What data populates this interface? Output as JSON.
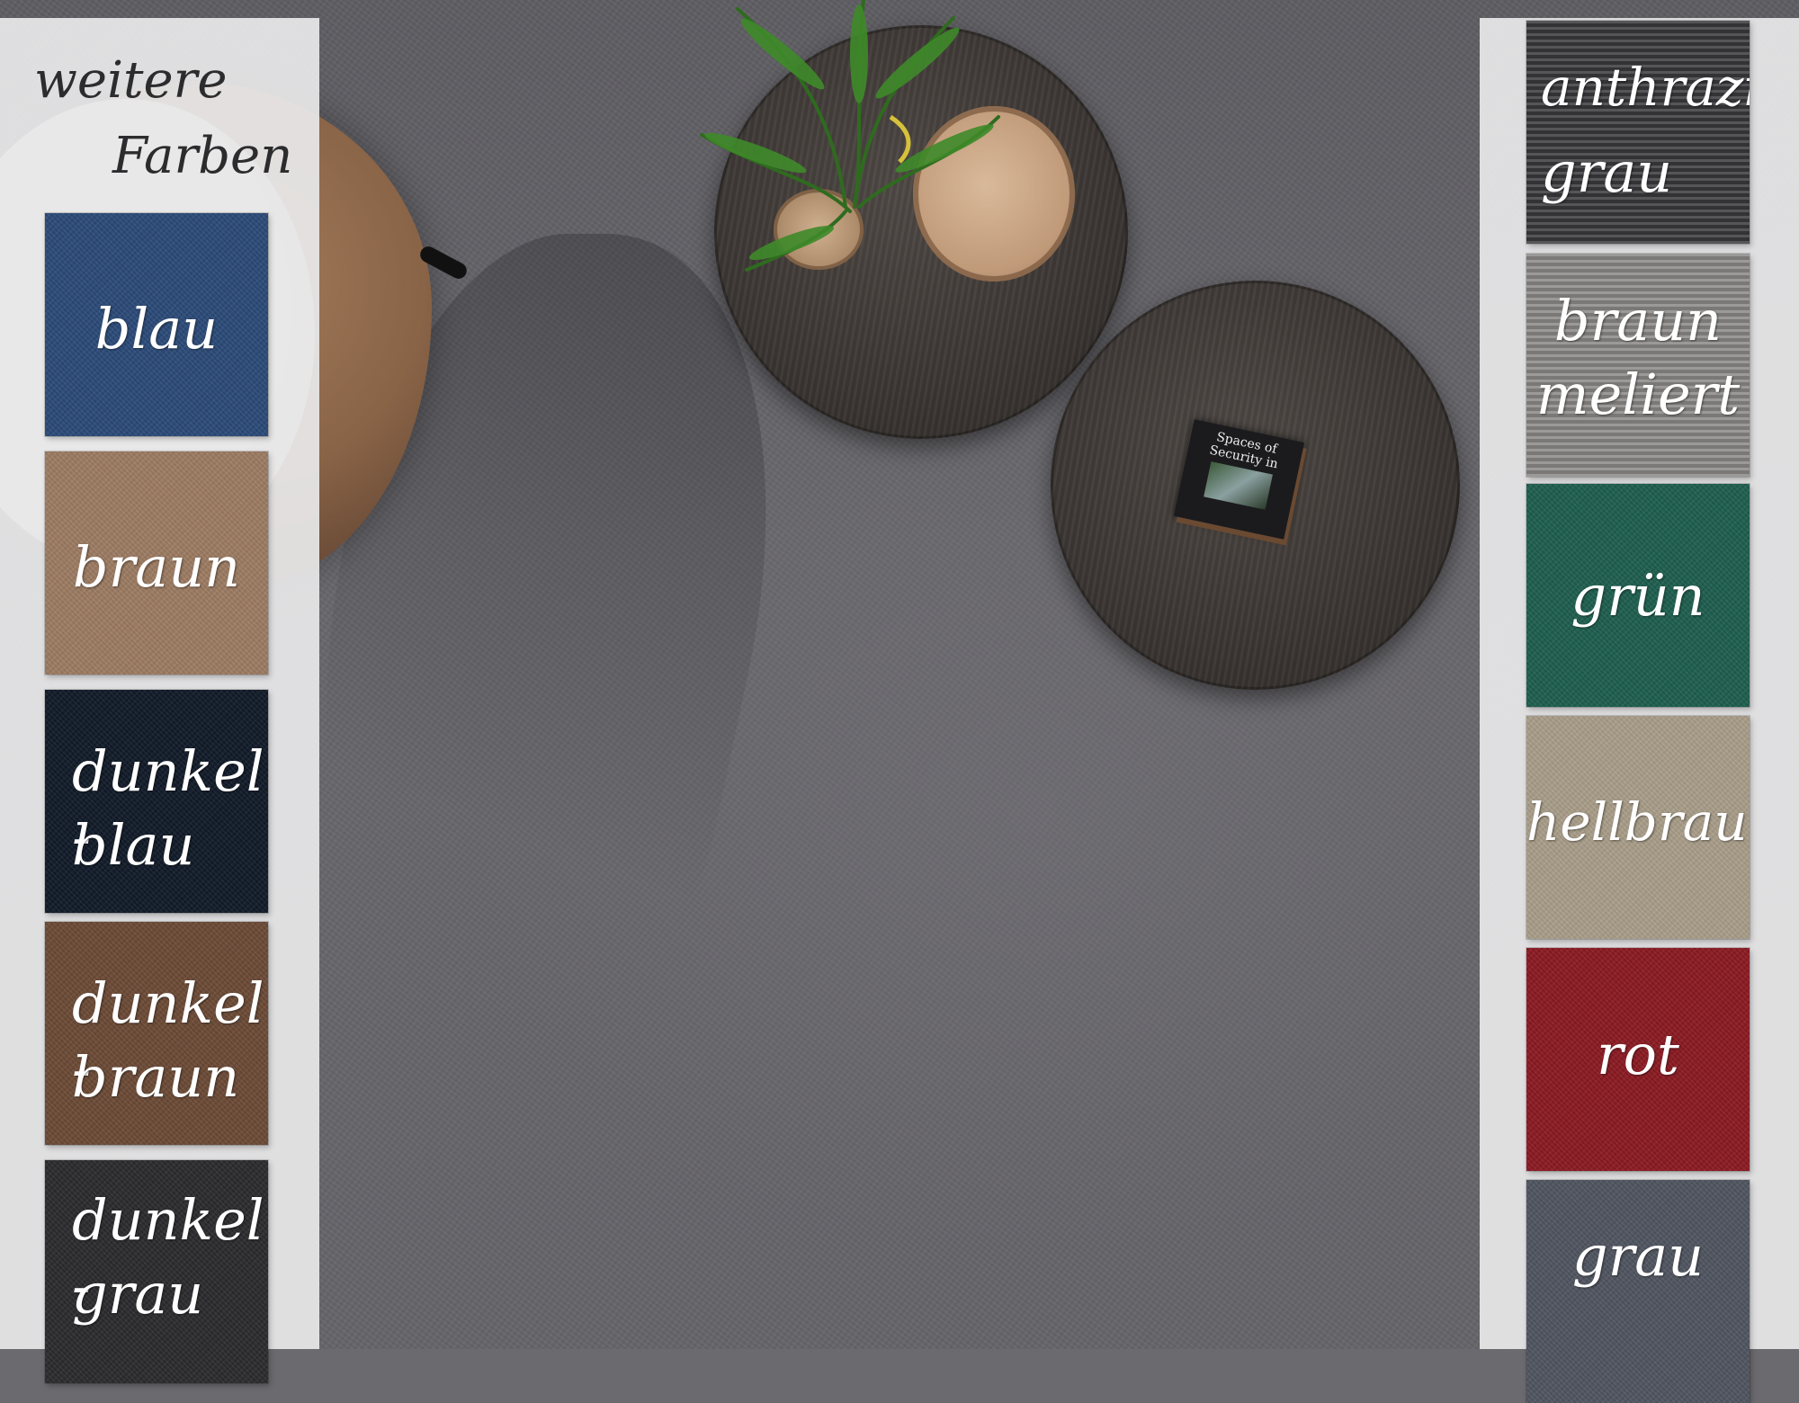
{
  "header": {
    "line1": "weitere",
    "line2": "Farben"
  },
  "left_swatches": [
    {
      "line1": "blau",
      "line2": "",
      "color": "#2b4a78"
    },
    {
      "line1": "braun",
      "line2": "",
      "color": "#9c7b62"
    },
    {
      "line1": "dunkel -",
      "line2": "blau",
      "color": "#111a28"
    },
    {
      "line1": "dunkel -",
      "line2": "braun",
      "color": "#6b4a36"
    },
    {
      "line1": "dunkel -",
      "line2": "grau",
      "color": "#2b2b2d"
    }
  ],
  "right_swatches": [
    {
      "line1": "anthrazit",
      "line2": "grau",
      "color": "#3a3a3e"
    },
    {
      "line1": "braun",
      "line2": "meliert",
      "color": "#8c8988"
    },
    {
      "line1": "grün",
      "line2": "",
      "color": "#1e5e4e"
    },
    {
      "line1": "hellbraun",
      "line2": "",
      "color": "#a89d88"
    },
    {
      "line1": "rot",
      "line2": "",
      "color": "#8a1a22"
    },
    {
      "line1": "grau",
      "line2": "",
      "color": "#4f5560"
    }
  ],
  "book": {
    "title": "Spaces of Security in"
  },
  "colors": {
    "carpet": "#67666b",
    "panel": "#e8e8ea"
  }
}
